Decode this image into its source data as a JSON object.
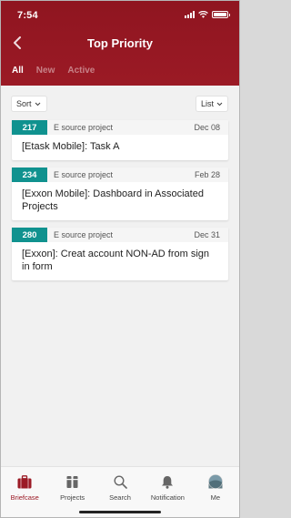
{
  "status_bar": {
    "time": "7:54"
  },
  "header": {
    "title": "Top Priority",
    "tabs": [
      {
        "label": "All",
        "active": true
      },
      {
        "label": "New",
        "active": false
      },
      {
        "label": "Active",
        "active": false
      }
    ]
  },
  "toolbar": {
    "sort_label": "Sort",
    "view_label": "List"
  },
  "tasks": [
    {
      "id": "217",
      "project": "E source project",
      "date": "Dec 08",
      "title": "[Etask Mobile]: Task A"
    },
    {
      "id": "234",
      "project": "E source project",
      "date": "Feb 28",
      "title": "[Exxon Mobile]:  Dashboard in Associated Projects"
    },
    {
      "id": "280",
      "project": "E source project",
      "date": "Dec 31",
      "title": "[Exxon]: Creat account NON-AD from sign in form"
    }
  ],
  "bottom_nav": [
    {
      "label": "Briefcase",
      "icon": "briefcase-icon",
      "active": true
    },
    {
      "label": "Projects",
      "icon": "projects-icon",
      "active": false
    },
    {
      "label": "Search",
      "icon": "search-icon",
      "active": false
    },
    {
      "label": "Notification",
      "icon": "bell-icon",
      "active": false
    },
    {
      "label": "Me",
      "icon": "avatar-icon",
      "active": false
    }
  ],
  "colors": {
    "brand": "#9b1a25",
    "accent": "#10928f"
  }
}
